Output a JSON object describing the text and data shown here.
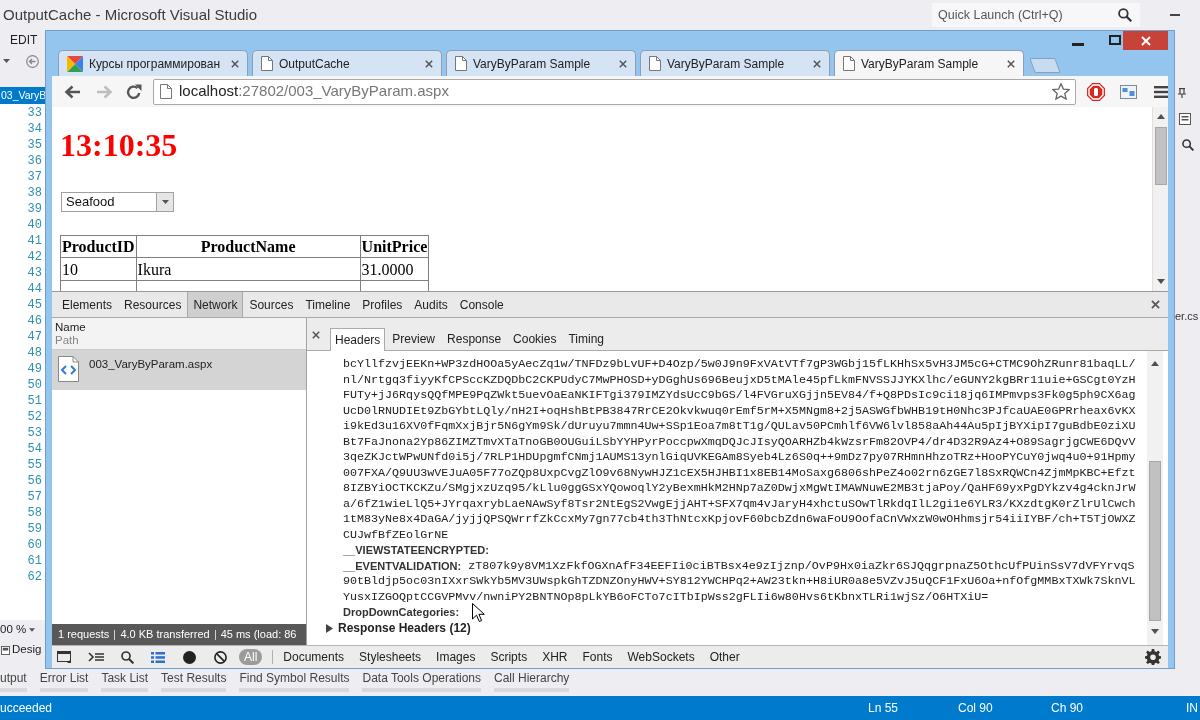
{
  "ide": {
    "title": "OutputCache - Microsoft Visual Studio",
    "quick_launch": {
      "placeholder": "Quick Launch (Ctrl+Q)"
    },
    "menu": [
      "EDIT"
    ],
    "document_tab": {
      "label": "03_VaryB",
      "selected": true
    },
    "line_numbers": [
      "33",
      "34",
      "35",
      "36",
      "37",
      "38",
      "39",
      "40",
      "41",
      "42",
      "43",
      "44",
      "45",
      "46",
      "47",
      "48",
      "49",
      "50",
      "51",
      "52",
      "53",
      "54",
      "55",
      "56",
      "57",
      "58",
      "59",
      "60",
      "61",
      "62"
    ],
    "zoom_level": "00 %",
    "view_tabs": [
      "Desig"
    ],
    "side_label": "er.cs",
    "tool_tabs": [
      "utput",
      "Error List",
      "Task List",
      "Test Results",
      "Find Symbol Results",
      "Data Tools Operations",
      "Call Hierarchy"
    ],
    "status_bar": {
      "message": "ucceeded",
      "line": "Ln 55",
      "column": "Col 90",
      "character": "Ch 90",
      "mode": "IN"
    }
  },
  "browser": {
    "tabs": [
      {
        "title": "Курсы программирован",
        "kind": "site",
        "selected": false
      },
      {
        "title": "OutputCache",
        "kind": "page",
        "selected": false
      },
      {
        "title": "VaryByParam Sample",
        "kind": "page",
        "selected": false
      },
      {
        "title": "VaryByParam Sample",
        "kind": "page",
        "selected": false
      },
      {
        "title": "VaryByParam Sample",
        "kind": "page",
        "selected": true
      }
    ],
    "navigation": {
      "back": {
        "disabled": false
      },
      "forward": {
        "disabled": true
      }
    },
    "address": {
      "host": "localhost",
      "path": ":27802/003_VaryByParam.aspx"
    },
    "page": {
      "time": "13:10:35",
      "category_dropdown": {
        "value": "Seafood"
      },
      "table": {
        "columns": [
          "ProductID",
          "ProductName",
          "UnitPrice"
        ],
        "rows": [
          [
            "10",
            "Ikura",
            "31.0000"
          ]
        ]
      }
    },
    "devtools": {
      "panels": [
        {
          "label": "Elements",
          "selected": false
        },
        {
          "label": "Resources",
          "selected": false
        },
        {
          "label": "Network",
          "selected": true
        },
        {
          "label": "Sources",
          "selected": false
        },
        {
          "label": "Timeline",
          "selected": false
        },
        {
          "label": "Profiles",
          "selected": false
        },
        {
          "label": "Audits",
          "selected": false
        },
        {
          "label": "Console",
          "selected": false
        }
      ],
      "requests": {
        "columns": [
          "Name",
          "Path"
        ],
        "items": [
          {
            "name": "003_VaryByParam.aspx",
            "selected": true
          }
        ],
        "summary": [
          "1 requests",
          "4.0 KB transferred",
          "45 ms (load: 86"
        ]
      },
      "detail_tabs": [
        {
          "label": "Headers",
          "selected": true
        },
        {
          "label": "Preview",
          "selected": false
        },
        {
          "label": "Response",
          "selected": false
        },
        {
          "label": "Cookies",
          "selected": false
        },
        {
          "label": "Timing",
          "selected": false
        }
      ],
      "form_data": {
        "continued_value": "bcYllfzvjEEKn+WP3zdHOOa5yAecZq1w/TNFDz9bLvUF+D4Ozp/5w0J9n9FxVAtVTf7gP3WGbj15fLKHhSx5vH3JM5cG+CTMC9OhZRunr81baqLL/nl/Nrtgq3fiyyKfCPSccKZDQDbC2CKPUdyC7MwPHOSD+yDGghUs696BeujxD5tMAle45pfLkmFNVSSJJYKXlhc/eGUNY2kgBRr11uie+GSCgt0YzHFUTy+jJ6RqysQQfMPE9PqZWkt5uevOaEaNKIFTgi379IMZYdsUcC9bGS/l4FVGruXGjjn5EV84/f+Q8PDsIc9ci18jq6IMPmvps3Fk0g5ph9CX6agUcD0lRNUDIEt9ZbGYbtLQly/nH2I+oqHshBtPB3847RrCE2Okvkwuq0rEmf5rM+X5MNgm8+2j5ASWGfbWHB19tH0Nhc3PJfcaUAE0GPRrheax6vKXi9kEd3u16XV0fFqmXxjBjr5N6gYm9Sk/dUruyu7mmn4Uw+SSp1Eoa7m8tT1g/QULav50PCmhlf6VW6lvl858aAh44Au5pIjBYXipI7guBdbE0ziXUBt7FaJnona2Yp86ZIMZTmvXTaTnoGB0OUGuiLSbYYHPyrPoccpwXmqDQJcJIsyQOARHZb4kWzsrFm82OVP4/dr4D32R9Az4+O89SagrjgCWE6DQvV3qeZKJctWPwUNfd0i5j/7RLP1HDUpgmfCNmj1AUMS13ynlGiqUVKEGAm8Syeb4Lz6S0q++9mDz7py07RHmnHhzoTRz+HooPYCuY0jwq4u0+91Hpmy007FXA/Q9UU3wVEJuA05F77oZQp8UxpCvgZlO9v68NywHJZ1cEX5HJHBI1x8EB14MoSaxg6806shPeZ4o02rn6zGE7l8SxRQWCn4ZjmMpKBC+Efzt8IZBYiOCTKCKZu/SMgjxzUzq95/kLlu0ggGSxYQowoqlY2yBexmHkM2HNp7aZ0DwjxMgWtIMAWNuwE2MB3tjaPoy/QaHF69yxPgDYkzv4g4cknJrWa/6fZ1wieLlQ5+JYrqaxrybLaeNAwSyf8Tsr2NtEgS2VwgEjjAHT+SFX7qm4vJaryH4xhctuSOwTlRkdqIlL2gi1e6YLR3/KXzdtgK0rZlrUlCwch1tM83yNe8x4DaGA/jyjjQPSQWrrfZkCcxMy7gn77cb4th3ThNtcxKpjovF60bcbZdn6waFoU9OofaCnVWxzW0wOHhmsjr54iiIYBF/ch+T5TjOWXZCUJwfBfZEolGrNE",
        "fields": [
          {
            "name": "__VIEWSTATEENCRYPTED:"
          },
          {
            "name": "__EVENTVALIDATION:",
            "value": "zT807k9y8VM1XzFkfOGXnAfF34EEFIi0ciBTBsx4e9zIjznp/OvP9Hx0iaZkr6SJQqgrpnaZ5OthcUfPUinSsV7dVFYrvqS90tBldjp5oc03nIXxrSWkYb5MV3UWspkGhTZDNZOnyHWV+SY812YWCHPq2+AW23tkn+H8iUR0a8e5VZvJ5uQCF1FxU6Oa+nfOfgMMBxTXWk7SknVLYusxIZGOQptCCGVPMvv/nwniPY2BNTNOp8pLkYB6oFCTo7cITbIpWss2gFLIi6w80Hvs6tKbnxTLRi1wjSz/O6HTXiU="
          },
          {
            "name": "DropDownCategories:"
          }
        ]
      },
      "sections": [
        {
          "label": "Response Headers (12)",
          "expanded": false
        }
      ],
      "filters": [
        {
          "label": "All",
          "selected": true
        },
        {
          "label": "Documents",
          "selected": false
        },
        {
          "label": "Stylesheets",
          "selected": false
        },
        {
          "label": "Images",
          "selected": false
        },
        {
          "label": "Scripts",
          "selected": false
        },
        {
          "label": "XHR",
          "selected": false
        },
        {
          "label": "Fonts",
          "selected": false
        },
        {
          "label": "WebSockets",
          "selected": false
        },
        {
          "label": "Other",
          "selected": false
        }
      ]
    }
  }
}
